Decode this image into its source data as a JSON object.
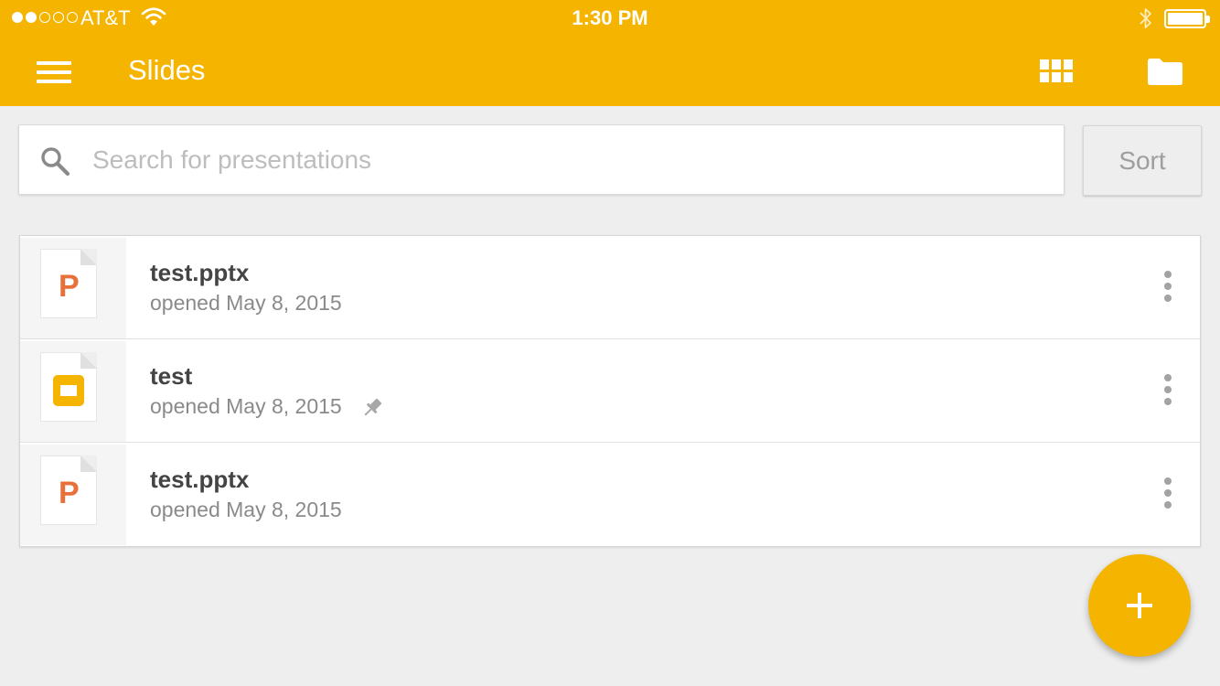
{
  "status_bar": {
    "signal_dots": {
      "filled": 2,
      "total": 5
    },
    "carrier": "AT&T",
    "time": "1:30 PM",
    "battery_icon": "battery-full-icon",
    "bluetooth_icon": "bluetooth-icon",
    "wifi_icon": "wifi-icon"
  },
  "appbar": {
    "title": "Slides",
    "menu_icon": "hamburger-menu-icon",
    "grid_view_icon": "grid-view-icon",
    "folder_icon": "folder-icon",
    "color": "#f4b400"
  },
  "search": {
    "placeholder": "Search for presentations",
    "value": "",
    "icon": "search-icon"
  },
  "sort": {
    "label": "Sort"
  },
  "files": [
    {
      "name": "test.pptx",
      "meta": "opened May 8, 2015",
      "type": "pptx",
      "pinned": false
    },
    {
      "name": "test",
      "meta": "opened May 8, 2015",
      "type": "slides",
      "pinned": true
    },
    {
      "name": "test.pptx",
      "meta": "opened May 8, 2015",
      "type": "pptx",
      "pinned": false
    }
  ],
  "file_type_glyphs": {
    "pptx": "P"
  },
  "fab": {
    "icon": "plus-icon",
    "color": "#f4b400"
  },
  "colors": {
    "accent": "#f4b400",
    "pptx": "#e8713b",
    "background": "#eeeeee"
  }
}
